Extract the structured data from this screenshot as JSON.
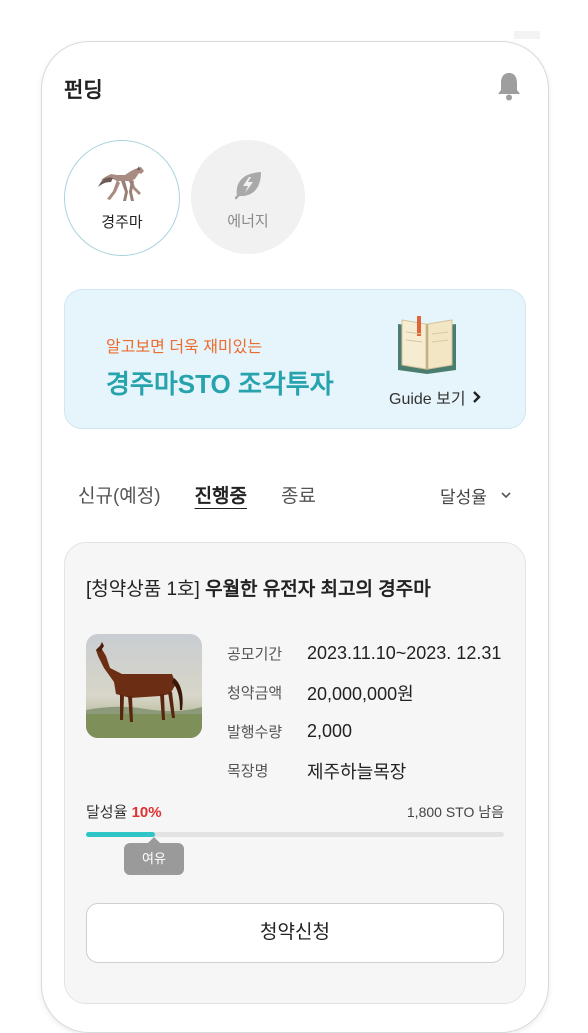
{
  "header": {
    "title": "펀딩"
  },
  "categories": [
    {
      "label": "경주마",
      "icon": "horse-icon",
      "selected": true
    },
    {
      "label": "에너지",
      "icon": "energy-leaf-icon",
      "selected": false
    }
  ],
  "banner": {
    "subtitle": "알고보면 더욱 재미있는",
    "title": "경주마STO 조각투자",
    "guide_label": "Guide 보기",
    "colors": {
      "subtitle": "#ec6c2f",
      "title": "#27a3ad",
      "bg": "#e6f4fb"
    }
  },
  "tabs": [
    {
      "label": "신규(예정)",
      "active": false
    },
    {
      "label": "진행중",
      "active": true
    },
    {
      "label": "종료",
      "active": false
    }
  ],
  "sort": {
    "label": "달성율"
  },
  "product": {
    "title_prefix": "[청약상품 1호]",
    "title_main": "우월한 유전자 최고의 경주마",
    "info": [
      {
        "key": "공모기간",
        "value": "2023.11.10~2023. 12.31"
      },
      {
        "key": "청약금액",
        "value": "20,000,000원"
      },
      {
        "key": "발행수량",
        "value": "2,000"
      },
      {
        "key": "목장명",
        "value": "제주하늘목장"
      }
    ],
    "progress_label": "달성율",
    "progress_pct_text": "10%",
    "progress_fraction": 0.165,
    "remaining": "1,800 STO 남음",
    "tooltip": "여유",
    "apply_label": "청약신청"
  }
}
